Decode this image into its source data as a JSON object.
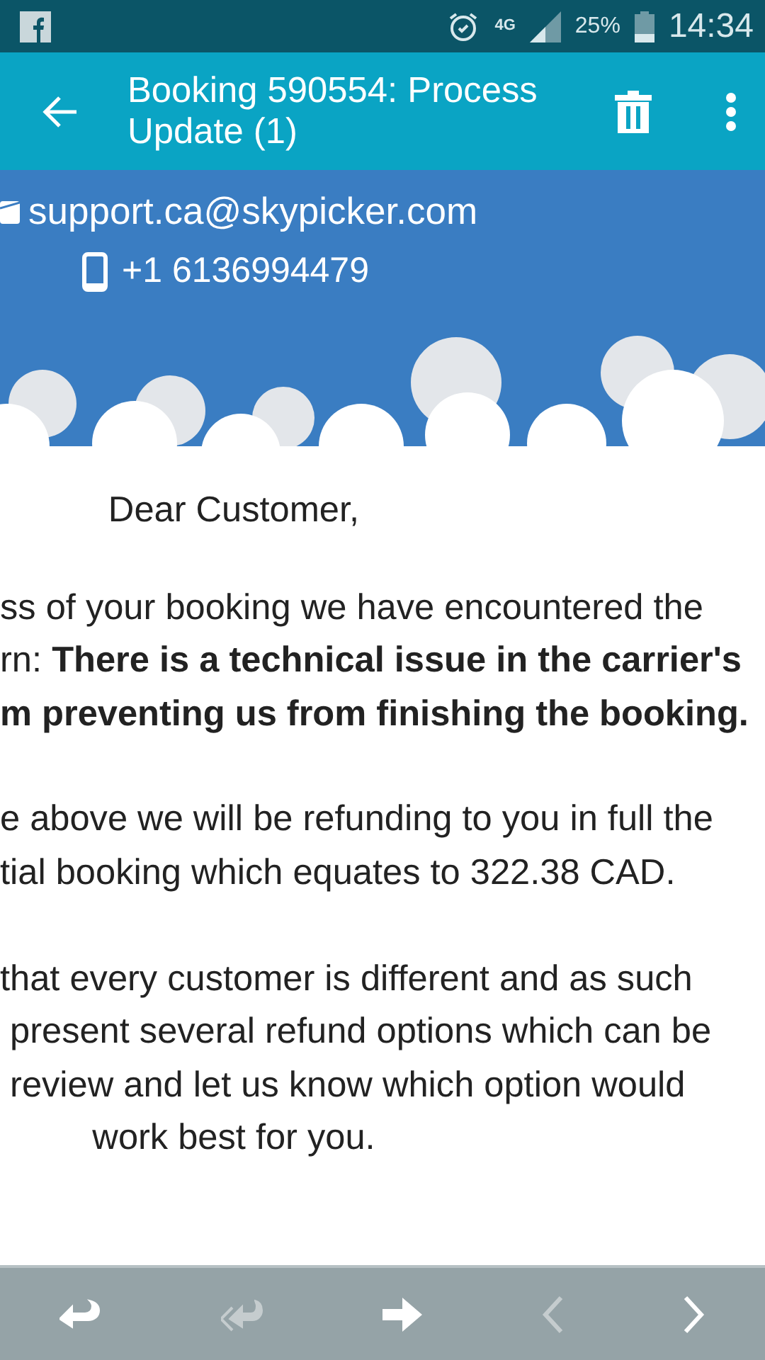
{
  "status_bar": {
    "network": "4G",
    "battery": "25%",
    "time": "14:34"
  },
  "app_bar": {
    "title": "Booking 590554: Process Update (1)"
  },
  "header": {
    "email": "support.ca@skypicker.com",
    "phone": "+1 6136994479"
  },
  "paragraphs": [
    {
      "lines": [
        {
          "kind": "centered",
          "text": "Dear Customer,"
        }
      ]
    },
    {
      "lines": [
        {
          "kind": "cut",
          "text": "ss of your booking we have encountered the"
        },
        {
          "kind": "cut",
          "text": "rn: **There is a technical issue in the carrier's**"
        },
        {
          "kind": "cut",
          "text": "**m preventing us from finishing the booking.**"
        }
      ]
    },
    {
      "lines": [
        {
          "kind": "cut",
          "text": "e above we will be refunding to you in full the"
        },
        {
          "kind": "cut",
          "text": "tial booking which equates to 322.38 CAD."
        }
      ]
    },
    {
      "lines": [
        {
          "kind": "cut",
          "text": "that every customer is different and as such"
        },
        {
          "kind": "cut",
          "text": " present several refund options which can be"
        },
        {
          "kind": "cut",
          "text": " review and let us know which option would"
        },
        {
          "kind": "centered",
          "text": "work best for you."
        }
      ]
    }
  ],
  "toolbar": [
    {
      "kind": "reply",
      "disabled": false
    },
    {
      "kind": "reply-all",
      "disabled": true
    },
    {
      "kind": "forward",
      "disabled": false
    },
    {
      "kind": "previous",
      "disabled": true
    },
    {
      "kind": "next",
      "disabled": false
    }
  ]
}
